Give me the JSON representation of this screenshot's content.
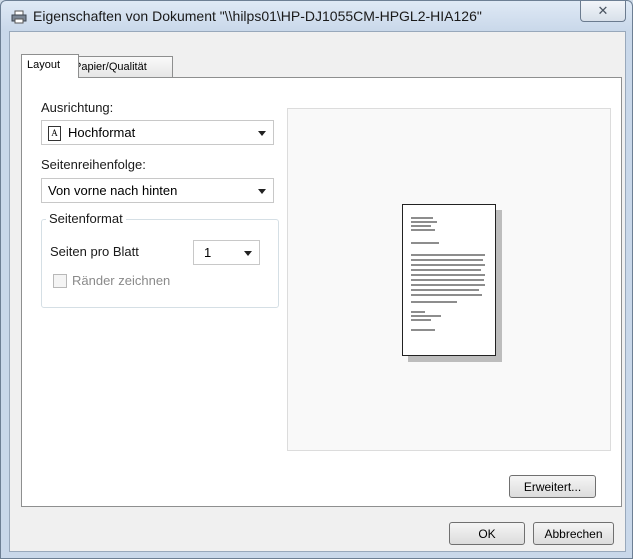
{
  "window": {
    "title": "Eigenschaften von Dokument \"\\\\hilps01\\HP-DJ1055CM-HPGL2-HIA126\"",
    "close_glyph": "✕"
  },
  "tabs": [
    {
      "label": "Layout",
      "active": true
    },
    {
      "label": "Papier/Qualität",
      "active": false
    }
  ],
  "layout": {
    "orientation_label": "Ausrichtung:",
    "orientation_value": "Hochformat",
    "orientation_icon_glyph": "A",
    "page_order_label": "Seitenreihenfolge:",
    "page_order_value": "Von vorne nach hinten",
    "page_format_group": "Seitenformat",
    "pages_per_sheet_label": "Seiten pro Blatt",
    "pages_per_sheet_value": "1",
    "draw_borders_label": "Ränder zeichnen",
    "draw_borders_checked": false,
    "draw_borders_enabled": false
  },
  "buttons": {
    "advanced": "Erweitert...",
    "ok": "OK",
    "cancel": "Abbrechen"
  },
  "icons": {
    "window": "printer-icon",
    "orientation": "portrait-page-icon"
  },
  "colors": {
    "titlebar": "#c9d8ea",
    "dialog_bg": "#f0f0f0",
    "panel_bg": "#ffffff",
    "disabled_text": "#8a8a8a"
  }
}
